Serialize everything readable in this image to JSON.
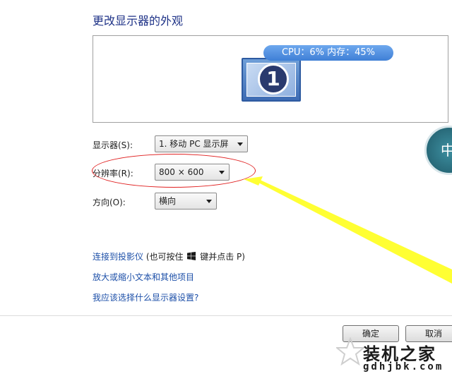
{
  "header": {
    "title": "更改显示器的外观"
  },
  "preview": {
    "monitor_number": "1",
    "overlay": "CPU：6%  内存：45%"
  },
  "form": {
    "display_label": "显示器(S):",
    "display_value": "1. 移动 PC 显示屏",
    "resolution_label": "分辨率(R):",
    "resolution_value": "800 × 600",
    "orientation_label": "方向(O):",
    "orientation_value": "横向"
  },
  "links": {
    "projector": "连接到投影仪",
    "projector_hint_prefix": "(也可按住",
    "projector_hint_suffix": "键并点击 P)",
    "text_size": "放大或缩小文本和其他项目",
    "which_settings": "我应该选择什么显示器设置?"
  },
  "buttons": {
    "ok": "确定",
    "cancel": "取消"
  },
  "overlays": {
    "badge": "中",
    "watermark_cn": "装机之家",
    "watermark_url": "gdhjbk.com"
  },
  "colors": {
    "title": "#1e3287",
    "link": "#1c4fa8",
    "annotation_arrow": "#ffff33",
    "annotation_ellipse": "#e02020"
  },
  "icons": {
    "windows_key": "windows-logo-icon",
    "dropdown": "chevron-down-icon"
  }
}
